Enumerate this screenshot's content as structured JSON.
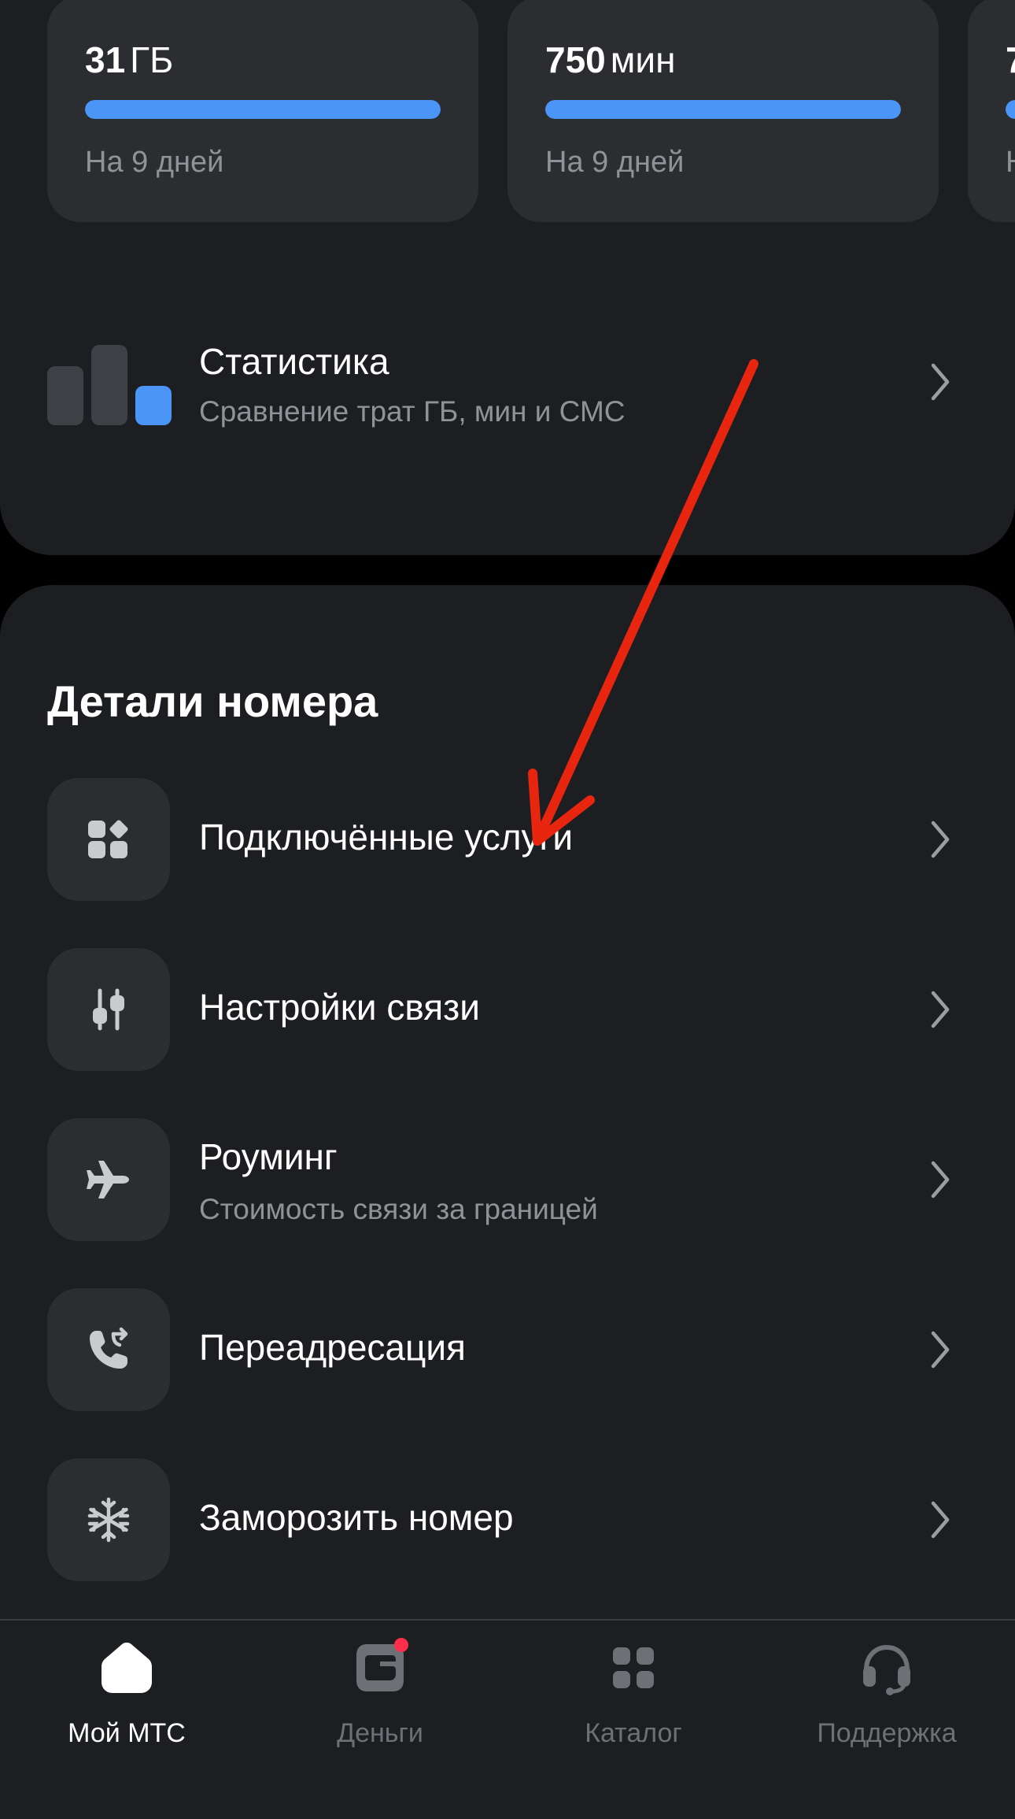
{
  "balances": [
    {
      "amount": "31",
      "unit": "ГБ",
      "period": "На 9 дней",
      "fill_percent": 100
    },
    {
      "amount": "750",
      "unit": "мин",
      "period": "На 9 дней",
      "fill_percent": 100
    },
    {
      "amount": "7",
      "unit": "",
      "period": "Н",
      "fill_percent": 100
    }
  ],
  "stats": {
    "title": "Статистика",
    "subtitle": "Сравнение трат ГБ, мин и СМС",
    "icon": "bar-chart-icon"
  },
  "details": {
    "title": "Детали номера",
    "items": [
      {
        "label": "Подключённые услуги",
        "subtitle": "",
        "icon": "services-grid-icon"
      },
      {
        "label": "Настройки связи",
        "subtitle": "",
        "icon": "sliders-icon"
      },
      {
        "label": "Роуминг",
        "subtitle": "Стоимость связи за границей",
        "icon": "airplane-icon"
      },
      {
        "label": "Переадресация",
        "subtitle": "",
        "icon": "phone-forward-icon"
      },
      {
        "label": "Заморозить номер",
        "subtitle": "",
        "icon": "snowflake-icon"
      }
    ]
  },
  "tabbar": {
    "tabs": [
      {
        "label": "Мой МТС",
        "icon": "home-icon",
        "active": true
      },
      {
        "label": "Деньги",
        "icon": "wallet-icon",
        "active": false,
        "badge": true
      },
      {
        "label": "Каталог",
        "icon": "catalog-grid-icon",
        "active": false
      },
      {
        "label": "Поддержка",
        "icon": "headset-icon",
        "active": false
      }
    ]
  },
  "colors": {
    "background": "#000000",
    "panel": "#1d1e21",
    "card": "#2b2d31",
    "accent_blue": "#4a95f5",
    "secondary_text": "#8f9297",
    "badge_red": "#ff2e4d",
    "annotation_red": "#e8260f"
  }
}
